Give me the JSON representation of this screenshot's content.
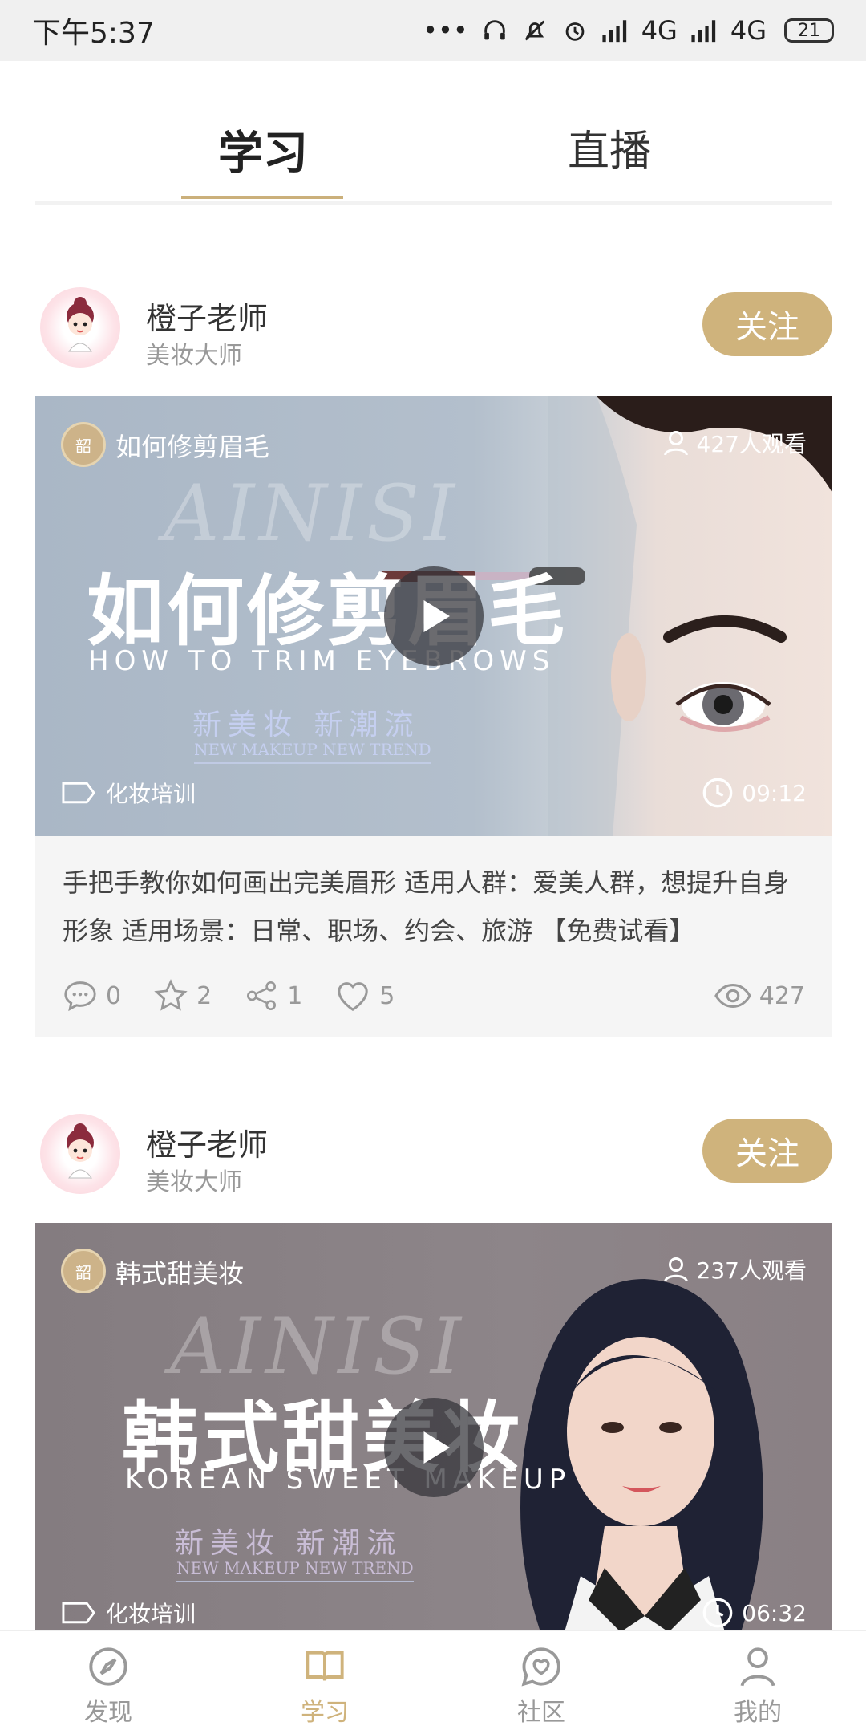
{
  "status_bar": {
    "time": "下午5:37",
    "network1": "4G",
    "network2": "4G",
    "battery": "21"
  },
  "tabs": [
    {
      "label": "学习",
      "active": true
    },
    {
      "label": "直播",
      "active": false
    }
  ],
  "accent_color": "#cfb37c",
  "posts": [
    {
      "author": "橙子老师",
      "author_title": "美妆大师",
      "follow_label": "关注",
      "cover_title": "如何修剪眉毛",
      "viewers": "427人观看",
      "badge_text": "韶",
      "watermark": "AINISI",
      "big_title": "如何修剪眉毛",
      "en_subtitle": "HOW TO TRIM EYEBROWS",
      "slogan": "新美妆  新潮流",
      "slogan_en": "NEW MAKEUP NEW TREND",
      "tag": "化妆培训",
      "duration": "09:12",
      "description": "手把手教你如何画出完美眉形  适用人群：爱美人群，想提升自身形象  适用场景：日常、职场、约会、旅游 【免费试看】",
      "comments": "0",
      "stars": "2",
      "shares": "1",
      "likes": "5",
      "views": "427"
    },
    {
      "author": "橙子老师",
      "author_title": "美妆大师",
      "follow_label": "关注",
      "cover_title": "韩式甜美妆",
      "viewers": "237人观看",
      "badge_text": "韶",
      "watermark": "AINISI",
      "big_title": "韩式甜美妆",
      "en_subtitle": "KOREAN SWEET MAKEUP",
      "slogan": "新美妆  新潮流",
      "slogan_en": "NEW MAKEUP NEW TREND",
      "tag": "化妆培训",
      "duration": "06:32"
    }
  ],
  "bottom_nav": [
    {
      "label": "发现",
      "icon": "compass-icon",
      "active": false
    },
    {
      "label": "学习",
      "icon": "book-icon",
      "active": true
    },
    {
      "label": "社区",
      "icon": "chat-heart-icon",
      "active": false
    },
    {
      "label": "我的",
      "icon": "user-icon",
      "active": false
    }
  ]
}
